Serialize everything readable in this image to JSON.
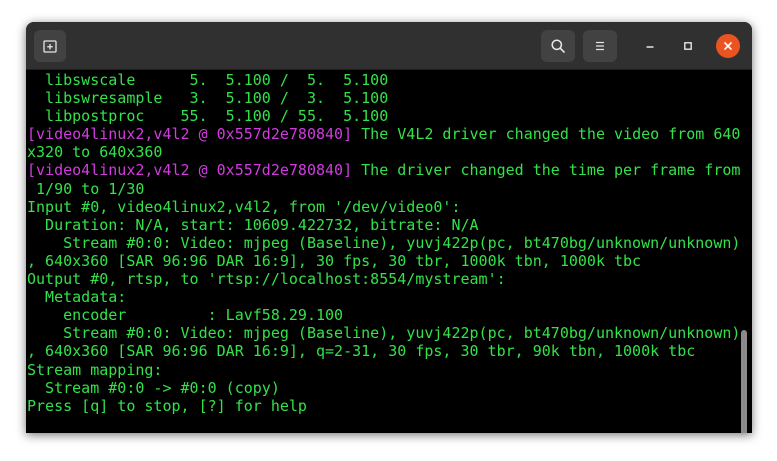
{
  "titlebar": {
    "new_tab_icon": "new-tab-icon",
    "search_icon": "search-icon",
    "menu_icon": "hamburger-menu-icon",
    "minimize_icon": "minimize-icon",
    "maximize_icon": "maximize-icon",
    "close_icon": "close-icon"
  },
  "colors": {
    "terminal_bg": "#000000",
    "text_green": "#33e24a",
    "text_magenta": "#d23be0",
    "titlebar_bg": "#303030",
    "close_button": "#e95420"
  },
  "terminal": {
    "lines": [
      [
        {
          "t": "  libswscale      5.  5.100 /  5.  5.100",
          "c": "green"
        }
      ],
      [
        {
          "t": "  libswresample   3.  5.100 /  3.  5.100",
          "c": "green"
        }
      ],
      [
        {
          "t": "  libpostproc    55.  5.100 / 55.  5.100",
          "c": "green"
        }
      ],
      [
        {
          "t": "[video4linux2,v4l2 @ 0x557d2e780840]",
          "c": "magenta"
        },
        {
          "t": " The V4L2 driver changed the video from 640",
          "c": "green"
        }
      ],
      [
        {
          "t": "x320 to 640x360",
          "c": "green"
        }
      ],
      [
        {
          "t": "[video4linux2,v4l2 @ 0x557d2e780840]",
          "c": "magenta"
        },
        {
          "t": " The driver changed the time per frame from",
          "c": "green"
        }
      ],
      [
        {
          "t": " 1/90 to 1/30",
          "c": "green"
        }
      ],
      [
        {
          "t": "Input #0, video4linux2,v4l2, from '/dev/video0':",
          "c": "green"
        }
      ],
      [
        {
          "t": "  Duration: N/A, start: 10609.422732, bitrate: N/A",
          "c": "green"
        }
      ],
      [
        {
          "t": "    Stream #0:0: Video: mjpeg (Baseline), yuvj422p(pc, bt470bg/unknown/unknown)",
          "c": "green"
        }
      ],
      [
        {
          "t": ", 640x360 [SAR 96:96 DAR 16:9], 30 fps, 30 tbr, 1000k tbn, 1000k tbc",
          "c": "green"
        }
      ],
      [
        {
          "t": "Output #0, rtsp, to 'rtsp://localhost:8554/mystream':",
          "c": "green"
        }
      ],
      [
        {
          "t": "  Metadata:",
          "c": "green"
        }
      ],
      [
        {
          "t": "    encoder         : Lavf58.29.100",
          "c": "green"
        }
      ],
      [
        {
          "t": "    Stream #0:0: Video: mjpeg (Baseline), yuvj422p(pc, bt470bg/unknown/unknown)",
          "c": "green"
        }
      ],
      [
        {
          "t": ", 640x360 [SAR 96:96 DAR 16:9], q=2-31, 30 fps, 30 tbr, 90k tbn, 1000k tbc",
          "c": "green"
        }
      ],
      [
        {
          "t": "Stream mapping:",
          "c": "green"
        }
      ],
      [
        {
          "t": "  Stream #0:0 -> #0:0 (copy)",
          "c": "green"
        }
      ],
      [
        {
          "t": "Press [q] to stop, [?] for help",
          "c": "green"
        }
      ]
    ]
  }
}
